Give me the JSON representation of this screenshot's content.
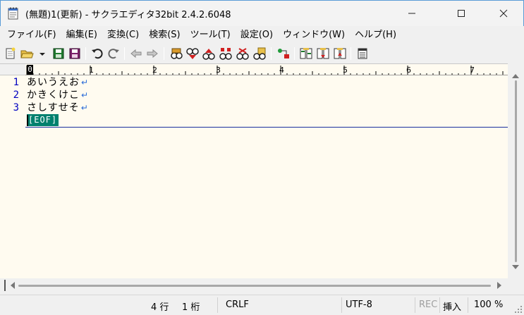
{
  "window": {
    "title": "(無題)1(更新) - サクラエディタ32bit 2.4.2.6048"
  },
  "menu": [
    "ファイル(F)",
    "編集(E)",
    "変換(C)",
    "検索(S)",
    "ツール(T)",
    "設定(O)",
    "ウィンドウ(W)",
    "ヘルプ(H)"
  ],
  "toolbar": {
    "icons": [
      "new-file-icon",
      "open-file-icon",
      "dropdown-icon",
      "save-icon",
      "save-all-icon",
      "undo-icon",
      "redo-icon",
      "back-icon",
      "forward-icon",
      "search-icon",
      "search-down-icon",
      "search-up-icon",
      "replace-icon",
      "clear-marks-icon",
      "grep-icon",
      "outline-icon",
      "compare-icon",
      "compare-next-icon",
      "compare-prev-icon",
      "window-list-icon"
    ]
  },
  "ruler": {
    "cursor_label": "0",
    "labels": [
      "1",
      "2",
      "3",
      "4",
      "5",
      "6",
      "7"
    ]
  },
  "editor": {
    "lines": [
      {
        "number": "1",
        "text": "あいうえお"
      },
      {
        "number": "2",
        "text": "かきくけこ"
      },
      {
        "number": "3",
        "text": "さしすせそ"
      }
    ],
    "eol_mark": "↵",
    "eof_label": "[EOF]"
  },
  "status": {
    "line": "4 行",
    "col": "1 桁",
    "newline": "CRLF",
    "encoding": "UTF-8",
    "rec": "REC",
    "insert_mode": "挿入",
    "zoom": "100 %"
  },
  "colors": {
    "editor_bg": "#fffbf0",
    "line_number": "#0000c0",
    "eof_bg": "#00806e",
    "eol": "#2a6bd8"
  }
}
